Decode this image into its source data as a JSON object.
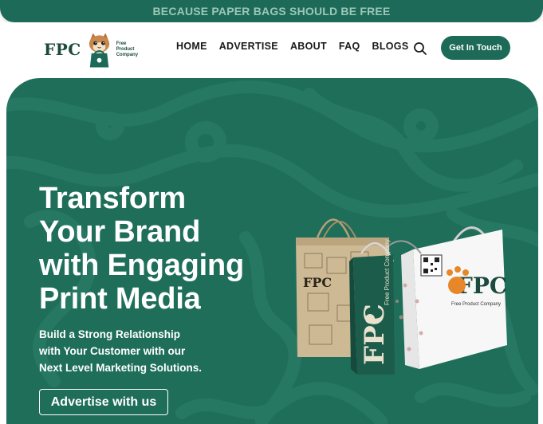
{
  "announcement": "BECAUSE PAPER BAGS SHOULD BE FREE",
  "logo": {
    "wordmark": "FPC",
    "tagline": [
      "Free",
      "Product",
      "Company"
    ]
  },
  "nav": {
    "items": [
      "HOME",
      "ADVERTISE",
      "ABOUT",
      "FAQ",
      "BLOGS"
    ],
    "search_icon": "search-icon"
  },
  "cta": {
    "label": "Get In Touch"
  },
  "hero": {
    "title_lines": [
      "Transform",
      "Your Brand",
      "with Engaging",
      "Print Media"
    ],
    "subtitle_lines": [
      "Build a Strong Relationship",
      "with Your Customer with our",
      "Next Level Marketing Solutions."
    ],
    "button_label": "Advertise with us"
  },
  "bags": {
    "kraft_label": "FPC",
    "green_label": "FPC",
    "green_tagline": "Free Product Company",
    "white_label": "FPC",
    "white_tagline": "Free Product Company"
  },
  "colors": {
    "brand_green": "#1c6a57",
    "hero_green": "#1f6e5a",
    "banner_text": "#9cc7b8",
    "accent_orange": "#e8872a"
  }
}
